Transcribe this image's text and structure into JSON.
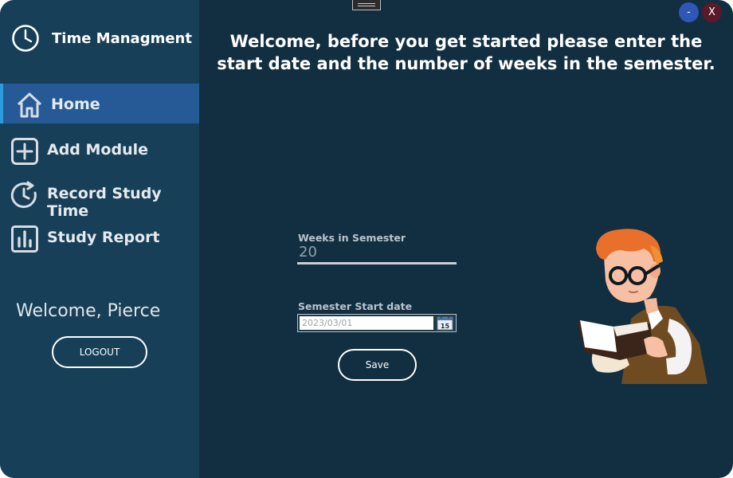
{
  "app": {
    "title": "Time Managment"
  },
  "sidebar": {
    "items": [
      {
        "label": "Home",
        "icon": "home-icon",
        "active": true
      },
      {
        "label": "Add Module",
        "icon": "plus-square-icon",
        "active": false
      },
      {
        "label": "Record Study Time",
        "icon": "clock-refresh-icon",
        "active": false
      },
      {
        "label": "Study Report",
        "icon": "bar-chart-icon",
        "active": false
      }
    ],
    "welcome": "Welcome, Pierce",
    "logout_label": "LOGOUT"
  },
  "window": {
    "minimize_label": "-",
    "close_label": "X"
  },
  "main": {
    "headline": "Welcome, before you get started please enter the start date and the number of weeks in the semester.",
    "weeks": {
      "label": "Weeks in Semester",
      "value": "20"
    },
    "start_date": {
      "label": "Semester Start date",
      "value": "2023/03/01",
      "calendar_day": "15"
    },
    "save_label": "Save"
  },
  "colors": {
    "main_bg": "#112f40",
    "sidebar_bg": "#173f57",
    "active_nav": "#265a96",
    "active_nav_accent": "#2d9cdb",
    "minimize_button": "#2f57b8",
    "close_button": "#5a1a28"
  }
}
